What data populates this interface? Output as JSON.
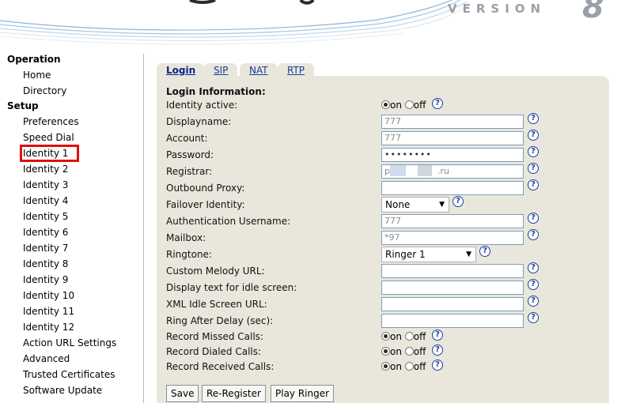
{
  "header": {
    "version_label": "VERSION",
    "version_number": "8"
  },
  "sidebar": {
    "sections": [
      "Operation",
      "Setup"
    ],
    "operation_items": [
      "Home",
      "Directory"
    ],
    "setup_items": [
      "Preferences",
      "Speed Dial",
      "Identity 1",
      "Identity 2",
      "Identity 3",
      "Identity 4",
      "Identity 5",
      "Identity 6",
      "Identity 7",
      "Identity 8",
      "Identity 9",
      "Identity 10",
      "Identity 11",
      "Identity 12",
      "Action URL Settings",
      "Advanced",
      "Trusted Certificates",
      "Software Update"
    ],
    "highlighted_item": "Identity 1",
    "highlight_color": "#e01010"
  },
  "tabs": [
    "Login",
    "SIP",
    "NAT",
    "RTP"
  ],
  "form": {
    "section_title": "Login Information:",
    "labels": {
      "identity_active": "Identity active:",
      "displayname": "Displayname:",
      "account": "Account:",
      "password": "Password:",
      "registrar": "Registrar:",
      "outbound_proxy": "Outbound Proxy:",
      "failover_identity": "Failover Identity:",
      "auth_username": "Authentication Username:",
      "mailbox": "Mailbox:",
      "ringtone": "Ringtone:",
      "custom_melody_url": "Custom Melody URL:",
      "display_text_idle": "Display text for idle screen:",
      "xml_idle_url": "XML Idle Screen URL:",
      "ring_after_delay": "Ring After Delay (sec):",
      "record_missed": "Record Missed Calls:",
      "record_dialed": "Record Dialed Calls:",
      "record_received": "Record Received Calls:"
    },
    "values": {
      "displayname": "777",
      "account": "777",
      "password": "••••••••",
      "registrar_prefix": "p",
      "registrar_suffix": ".ru",
      "outbound_proxy": "",
      "failover_identity": "None",
      "auth_username": "777",
      "mailbox": "*97",
      "ringtone": "Ringer 1",
      "custom_melody_url": "",
      "display_text_idle": "",
      "xml_idle_url": "",
      "ring_after_delay": ""
    },
    "radio": {
      "on": "on",
      "off": "off"
    },
    "help_glyph": "?"
  },
  "buttons": {
    "save": "Save",
    "reregister": "Re-Register",
    "play_ringer": "Play Ringer"
  },
  "colors": {
    "panel_bg": "#e9e7dc",
    "link": "#1a3a9c",
    "help": "#1d3f9f"
  }
}
